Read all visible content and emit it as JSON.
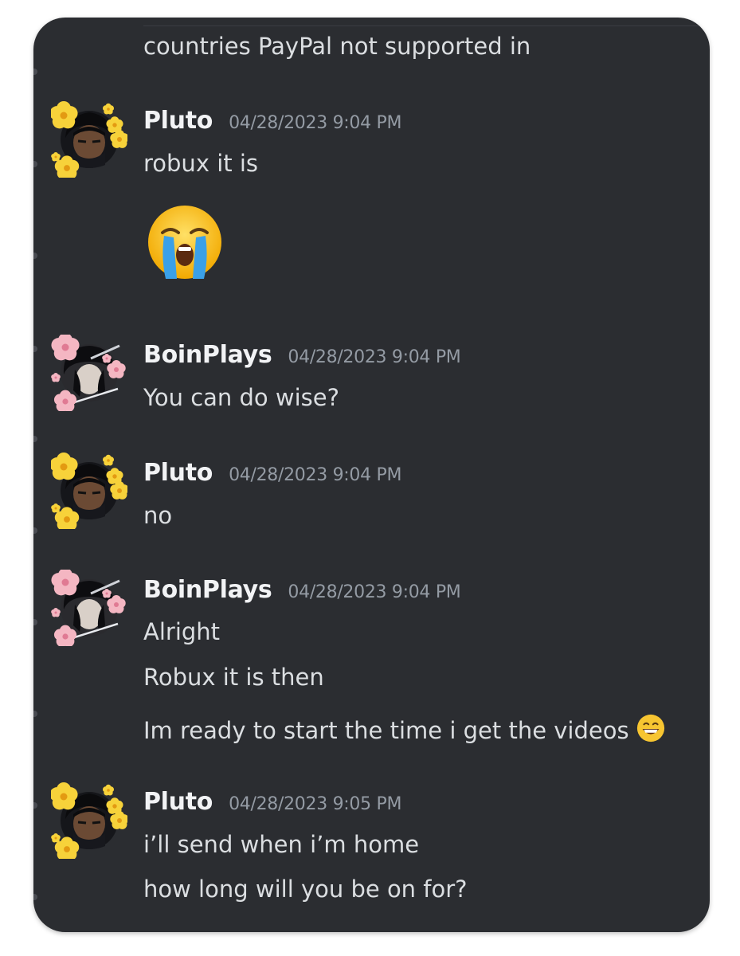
{
  "messages": {
    "top_continuation": "countries PayPal not supported in",
    "m1": {
      "author": "Pluto",
      "timestamp": "04/28/2023 9:04 PM",
      "lines": [
        "robux it is"
      ],
      "big_emoji": "loudly-crying-face-emoji"
    },
    "m2": {
      "author": "BoinPlays",
      "timestamp": "04/28/2023 9:04 PM",
      "lines": [
        "You can do wise?"
      ]
    },
    "m3": {
      "author": "Pluto",
      "timestamp": "04/28/2023 9:04 PM",
      "lines": [
        "no"
      ]
    },
    "m4": {
      "author": "BoinPlays",
      "timestamp": "04/28/2023 9:04 PM",
      "lines": [
        "Alright",
        "Robux it is then",
        "Im ready to start the time i get the videos"
      ],
      "inline_emoji": "grinning-face-emoji"
    },
    "m5": {
      "author": "Pluto",
      "timestamp": "04/28/2023 9:05 PM",
      "lines": [
        "i’ll send when i’m home",
        "how long will you be on for?"
      ]
    }
  },
  "colors": {
    "background": "#2b2d31",
    "author": "#f2f3f5",
    "message_text": "#dbdee1",
    "timestamp": "#949ba4",
    "pluto_flower": "#f7d23a",
    "boin_flower": "#f4b6c2"
  },
  "icons": {
    "pluto_avatar": "avatar-icon",
    "boin_avatar": "avatar-icon",
    "crying_emoji": "loudly-crying-face-icon",
    "grin_emoji": "grinning-face-icon"
  }
}
